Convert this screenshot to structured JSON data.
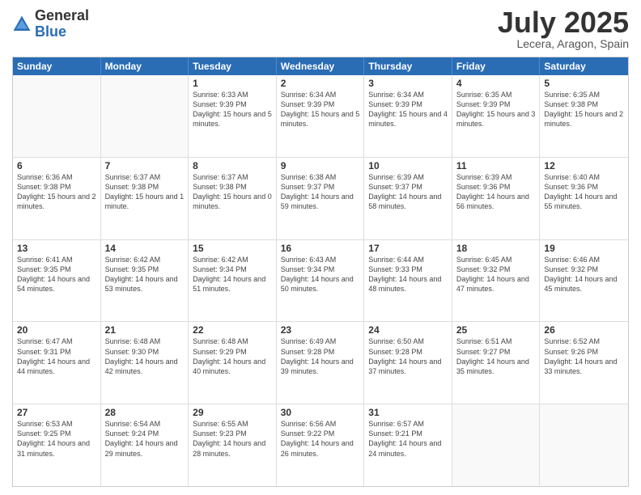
{
  "logo": {
    "general": "General",
    "blue": "Blue"
  },
  "header": {
    "month": "July 2025",
    "location": "Lecera, Aragon, Spain"
  },
  "weekdays": [
    "Sunday",
    "Monday",
    "Tuesday",
    "Wednesday",
    "Thursday",
    "Friday",
    "Saturday"
  ],
  "weeks": [
    [
      {
        "day": "",
        "info": ""
      },
      {
        "day": "",
        "info": ""
      },
      {
        "day": "1",
        "info": "Sunrise: 6:33 AM\nSunset: 9:39 PM\nDaylight: 15 hours and 5 minutes."
      },
      {
        "day": "2",
        "info": "Sunrise: 6:34 AM\nSunset: 9:39 PM\nDaylight: 15 hours and 5 minutes."
      },
      {
        "day": "3",
        "info": "Sunrise: 6:34 AM\nSunset: 9:39 PM\nDaylight: 15 hours and 4 minutes."
      },
      {
        "day": "4",
        "info": "Sunrise: 6:35 AM\nSunset: 9:39 PM\nDaylight: 15 hours and 3 minutes."
      },
      {
        "day": "5",
        "info": "Sunrise: 6:35 AM\nSunset: 9:38 PM\nDaylight: 15 hours and 2 minutes."
      }
    ],
    [
      {
        "day": "6",
        "info": "Sunrise: 6:36 AM\nSunset: 9:38 PM\nDaylight: 15 hours and 2 minutes."
      },
      {
        "day": "7",
        "info": "Sunrise: 6:37 AM\nSunset: 9:38 PM\nDaylight: 15 hours and 1 minute."
      },
      {
        "day": "8",
        "info": "Sunrise: 6:37 AM\nSunset: 9:38 PM\nDaylight: 15 hours and 0 minutes."
      },
      {
        "day": "9",
        "info": "Sunrise: 6:38 AM\nSunset: 9:37 PM\nDaylight: 14 hours and 59 minutes."
      },
      {
        "day": "10",
        "info": "Sunrise: 6:39 AM\nSunset: 9:37 PM\nDaylight: 14 hours and 58 minutes."
      },
      {
        "day": "11",
        "info": "Sunrise: 6:39 AM\nSunset: 9:36 PM\nDaylight: 14 hours and 56 minutes."
      },
      {
        "day": "12",
        "info": "Sunrise: 6:40 AM\nSunset: 9:36 PM\nDaylight: 14 hours and 55 minutes."
      }
    ],
    [
      {
        "day": "13",
        "info": "Sunrise: 6:41 AM\nSunset: 9:35 PM\nDaylight: 14 hours and 54 minutes."
      },
      {
        "day": "14",
        "info": "Sunrise: 6:42 AM\nSunset: 9:35 PM\nDaylight: 14 hours and 53 minutes."
      },
      {
        "day": "15",
        "info": "Sunrise: 6:42 AM\nSunset: 9:34 PM\nDaylight: 14 hours and 51 minutes."
      },
      {
        "day": "16",
        "info": "Sunrise: 6:43 AM\nSunset: 9:34 PM\nDaylight: 14 hours and 50 minutes."
      },
      {
        "day": "17",
        "info": "Sunrise: 6:44 AM\nSunset: 9:33 PM\nDaylight: 14 hours and 48 minutes."
      },
      {
        "day": "18",
        "info": "Sunrise: 6:45 AM\nSunset: 9:32 PM\nDaylight: 14 hours and 47 minutes."
      },
      {
        "day": "19",
        "info": "Sunrise: 6:46 AM\nSunset: 9:32 PM\nDaylight: 14 hours and 45 minutes."
      }
    ],
    [
      {
        "day": "20",
        "info": "Sunrise: 6:47 AM\nSunset: 9:31 PM\nDaylight: 14 hours and 44 minutes."
      },
      {
        "day": "21",
        "info": "Sunrise: 6:48 AM\nSunset: 9:30 PM\nDaylight: 14 hours and 42 minutes."
      },
      {
        "day": "22",
        "info": "Sunrise: 6:48 AM\nSunset: 9:29 PM\nDaylight: 14 hours and 40 minutes."
      },
      {
        "day": "23",
        "info": "Sunrise: 6:49 AM\nSunset: 9:28 PM\nDaylight: 14 hours and 39 minutes."
      },
      {
        "day": "24",
        "info": "Sunrise: 6:50 AM\nSunset: 9:28 PM\nDaylight: 14 hours and 37 minutes."
      },
      {
        "day": "25",
        "info": "Sunrise: 6:51 AM\nSunset: 9:27 PM\nDaylight: 14 hours and 35 minutes."
      },
      {
        "day": "26",
        "info": "Sunrise: 6:52 AM\nSunset: 9:26 PM\nDaylight: 14 hours and 33 minutes."
      }
    ],
    [
      {
        "day": "27",
        "info": "Sunrise: 6:53 AM\nSunset: 9:25 PM\nDaylight: 14 hours and 31 minutes."
      },
      {
        "day": "28",
        "info": "Sunrise: 6:54 AM\nSunset: 9:24 PM\nDaylight: 14 hours and 29 minutes."
      },
      {
        "day": "29",
        "info": "Sunrise: 6:55 AM\nSunset: 9:23 PM\nDaylight: 14 hours and 28 minutes."
      },
      {
        "day": "30",
        "info": "Sunrise: 6:56 AM\nSunset: 9:22 PM\nDaylight: 14 hours and 26 minutes."
      },
      {
        "day": "31",
        "info": "Sunrise: 6:57 AM\nSunset: 9:21 PM\nDaylight: 14 hours and 24 minutes."
      },
      {
        "day": "",
        "info": ""
      },
      {
        "day": "",
        "info": ""
      }
    ]
  ]
}
